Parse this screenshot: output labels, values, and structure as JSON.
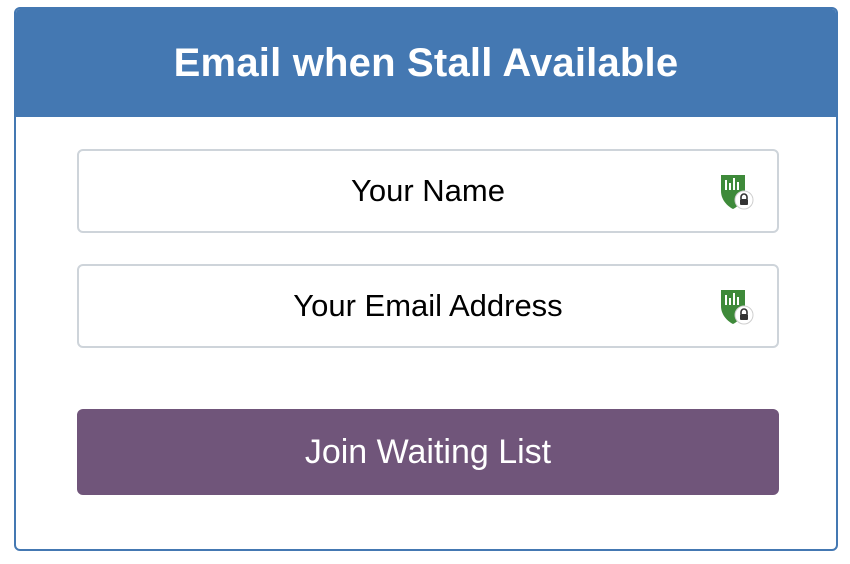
{
  "card": {
    "title": "Email when Stall Available"
  },
  "form": {
    "name_field": {
      "placeholder": "Your Name",
      "value": "",
      "icon": "password-manager-shield-icon"
    },
    "email_field": {
      "placeholder": "Your Email Address",
      "value": "",
      "icon": "password-manager-shield-icon"
    },
    "submit_label": "Join Waiting List"
  },
  "colors": {
    "header": "#4478b2",
    "button": "#70557a",
    "shield": "#3e8a3a",
    "input_border": "#ced4da"
  }
}
